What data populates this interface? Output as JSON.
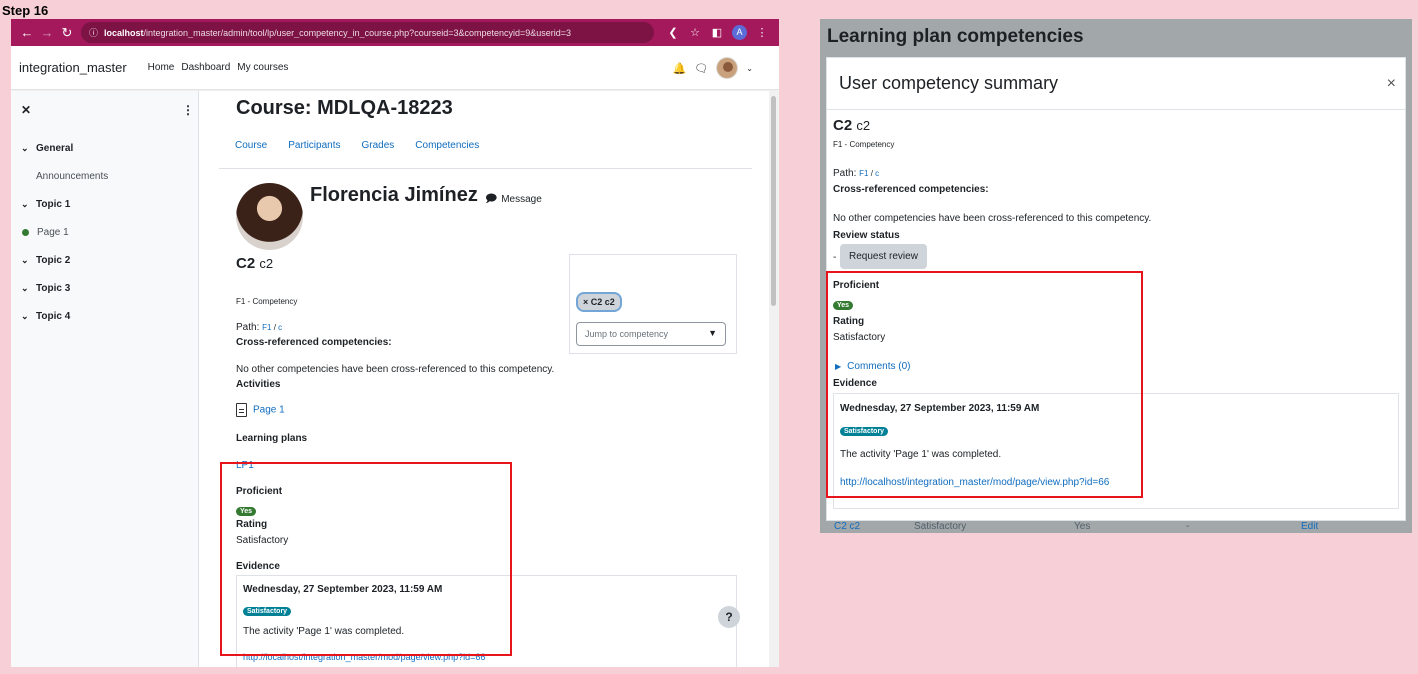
{
  "step_label": "Step 16",
  "browser": {
    "url_host": "localhost",
    "url_path": "/integration_master/admin/tool/lp/user_competency_in_course.php?courseid=3&competencyid=9&userid=3",
    "avatar_letter": "A"
  },
  "navbar": {
    "brand": "integration_master",
    "links": [
      "Home",
      "Dashboard",
      "My courses"
    ]
  },
  "drawer": {
    "items": [
      {
        "label": "General",
        "type": "section"
      },
      {
        "label": "Announcements",
        "type": "sub"
      },
      {
        "label": "Topic 1",
        "type": "section"
      },
      {
        "label": "Page 1",
        "type": "sub"
      },
      {
        "label": "Topic 2",
        "type": "section"
      },
      {
        "label": "Topic 3",
        "type": "section"
      },
      {
        "label": "Topic 4",
        "type": "section"
      }
    ]
  },
  "course": {
    "title": "Course: MDLQA-18223",
    "tabs": [
      "Course",
      "Participants",
      "Grades",
      "Competencies"
    ]
  },
  "user": {
    "name": "Florencia Jimínez",
    "message": "Message"
  },
  "competency": {
    "shortname": "C2",
    "idnumber": "c2",
    "framework": "F1 - Competency",
    "path_label": "Path:",
    "path_f1": "F1",
    "path_sep": " / ",
    "path_c": "c",
    "crossref_heading": "Cross-referenced competencies:",
    "crossref_text": "No other competencies have been cross-referenced to this competency.",
    "activities_heading": "Activities",
    "activity": "Page 1",
    "learning_plans_heading": "Learning plans",
    "learning_plan": "LP1",
    "proficient_heading": "Proficient",
    "proficient_value": "Yes",
    "rating_heading": "Rating",
    "rating_value": "Satisfactory",
    "evidence_heading": "Evidence",
    "evidence": {
      "date": "Wednesday, 27 September 2023, 11:59 AM",
      "badge": "Satisfactory",
      "text": "The activity 'Page 1' was completed.",
      "link": "http://localhost/integration_master/mod/page/view.php?id=66"
    }
  },
  "side": {
    "pill": "× C2 c2",
    "jump_placeholder": "Jump to competency"
  },
  "help_label": "?",
  "right_panel": {
    "page_title": "Learning plan competencies",
    "modal_title": "User competency summary",
    "close": "×",
    "review_status_heading": "Review status",
    "review_dash": "-",
    "request_review": "Request review",
    "comments": "Comments (0)",
    "under_row": [
      "C2 c2",
      "Satisfactory",
      "Yes",
      "-",
      "Edit"
    ]
  },
  "colors": {
    "page_bg": "#f6d0d6",
    "chrome": "#a3195b",
    "highlight": "#e8141c",
    "link": "#0f6cbf",
    "badge_yes": "#357a32",
    "badge_satisfactory": "#008196"
  }
}
